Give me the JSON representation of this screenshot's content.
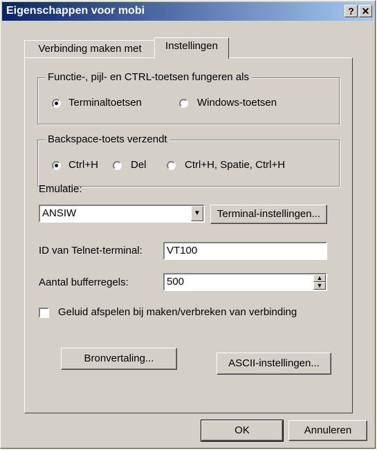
{
  "window": {
    "title": "Eigenschappen voor mobi",
    "help_label": "?",
    "close_label": "✕"
  },
  "tabs": [
    {
      "label": "Verbinding maken met",
      "active": false
    },
    {
      "label": "Instellingen",
      "active": true
    }
  ],
  "function_keys": {
    "legend": "Functie-, pijl- en CTRL-toetsen fungeren als",
    "options": [
      {
        "label": "Terminaltoetsen",
        "selected": true
      },
      {
        "label": "Windows-toetsen",
        "selected": false
      }
    ]
  },
  "backspace": {
    "legend": "Backspace-toets verzendt",
    "options": [
      {
        "label": "Ctrl+H",
        "selected": true
      },
      {
        "label": "Del",
        "selected": false
      },
      {
        "label": "Ctrl+H, Spatie, Ctrl+H",
        "selected": false
      }
    ]
  },
  "emulation": {
    "label": "Emulatie:",
    "selected": "ANSIW",
    "terminal_settings_button": "Terminal-instellingen..."
  },
  "telnet_id": {
    "label": "ID van Telnet-terminal:",
    "value": "VT100"
  },
  "buffer_lines": {
    "label": "Aantal bufferregels:",
    "value": "500"
  },
  "sound_checkbox": {
    "label": "Geluid afspelen bij maken/verbreken van verbinding",
    "checked": false
  },
  "buttons": {
    "translation": "Bronvertaling...",
    "ascii": "ASCII-instellingen...",
    "ok": "OK",
    "cancel": "Annuleren"
  }
}
